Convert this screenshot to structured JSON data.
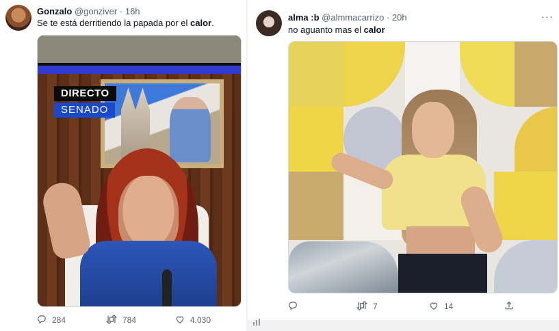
{
  "tweets": [
    {
      "name": "Gonzalo",
      "handle": "@gonziver",
      "time": "16h",
      "text_before": "Se te está derritiendo la papada por el ",
      "text_bold": "calor",
      "text_after": ".",
      "media": {
        "overlay_line1": "DIRECTO",
        "overlay_line2": "SENADO"
      },
      "actions": {
        "replies": "284",
        "retweets": "784",
        "likes": "4.030"
      }
    },
    {
      "name": "alma :b",
      "handle": "@almmacarrizo",
      "time": "20h",
      "text_before": "no aguanto mas el ",
      "text_bold": "calor",
      "text_after": "",
      "actions": {
        "replies": "",
        "retweets": "7",
        "likes": "14"
      }
    }
  ],
  "separator": "·",
  "icons": {
    "reply": "reply-icon",
    "retweet": "retweet-icon",
    "like": "heart-icon",
    "share": "share-icon",
    "more": "more-icon"
  },
  "colors": {
    "text": "#0f1419",
    "muted": "#536471",
    "senado_blue": "#1a49c9"
  }
}
